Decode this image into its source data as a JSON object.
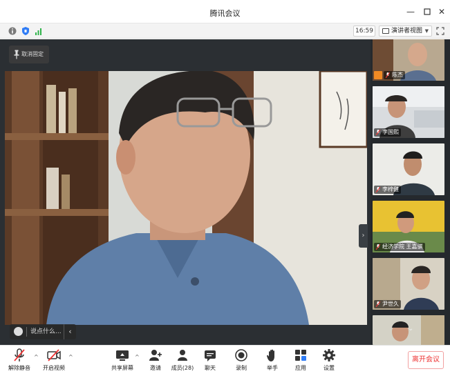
{
  "window": {
    "title": "腾讯会议"
  },
  "infobar": {
    "time": "16:59",
    "view_mode": "演讲者视图"
  },
  "stage": {
    "unpin_label": "取消固定",
    "chat_placeholder": "说点什么..."
  },
  "participants": [
    {
      "name": "陈杰"
    },
    {
      "name": "李国熙"
    },
    {
      "name": "李梓健"
    },
    {
      "name": "经济学院 王嘉骐"
    },
    {
      "name": "尹世久"
    },
    {
      "name": ""
    }
  ],
  "toolbar": {
    "unmute": "解除静音",
    "start_video": "开启视频",
    "share_screen": "共享屏幕",
    "invite": "邀请",
    "members": "成员(28)",
    "chat": "聊天",
    "record": "录制",
    "raise_hand": "举手",
    "apps": "应用",
    "settings": "设置",
    "leave": "离开会议"
  },
  "colors": {
    "accent_blue": "#2f7cf6",
    "leave_red": "#e33333",
    "stage_bg": "#2b2f33"
  }
}
